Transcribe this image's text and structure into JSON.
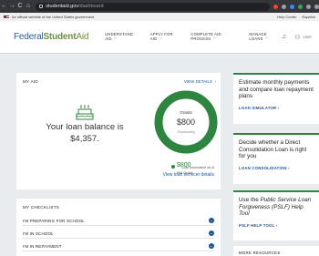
{
  "browser": {
    "back": "←",
    "forward": "→",
    "reload": "C",
    "home": "⌂",
    "url_host": "studentaid.gov",
    "url_path": "/dashboard"
  },
  "gov_banner": {
    "text": "An official website of the United States government",
    "help": "Help Center",
    "lang": "Español"
  },
  "header": {
    "logo_a": "Federal",
    "logo_b": "Student",
    "logo_c": "Aid",
    "nav": [
      "UNDERSTAND AID",
      "APPLY FOR AID",
      "COMPLETE AID PROCESS",
      "MANAGE LOANS"
    ],
    "user_label": "User"
  },
  "my_aid": {
    "title": "MY AID",
    "view_details": "VIEW DETAILS",
    "balance_line1": "Your loan balance is",
    "balance_line2": "$4,357.",
    "ring_label": "Grants",
    "ring_amount": "$800",
    "ring_sub": "Outstanding",
    "legend_amount": "$800",
    "legend_label": "Pell Grant",
    "loan_info": "Loan information as of",
    "view_loan_details": "View loan servicer details"
  },
  "checklists": {
    "title": "MY CHECKLISTS",
    "items": [
      "I'M PREPARING FOR SCHOOL",
      "I'M IN SCHOOL",
      "I'M IN REPAYMENT"
    ]
  },
  "side_cards": [
    {
      "title": "Estimate monthly payments and compare loan repayment plans",
      "link": "LOAN SIMULATOR"
    },
    {
      "title": "Decide whether a Direct Consolidation Loan is right for you",
      "link": "LOAN CONSOLIDATION"
    },
    {
      "title_pre": "Use the ",
      "title_em": "Public Service Loan Forgiveness (PSLF) Help Tool",
      "link": "PSLF HELP TOOL"
    },
    {
      "title": "MORE RESOURCES"
    }
  ],
  "colors": {
    "accent_green": "#2e8540",
    "link_blue": "#205493",
    "page_bg": "#e9ecef"
  }
}
